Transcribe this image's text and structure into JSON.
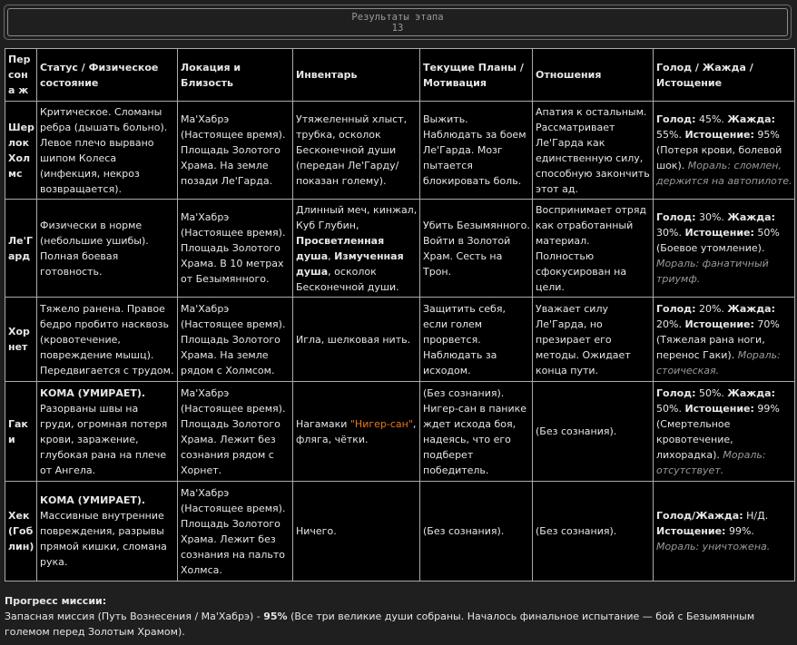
{
  "header": {
    "title": "Результаты этапа",
    "number": "13"
  },
  "columns": [
    "Пер сона ж",
    "Статус / Физическое состояние",
    "Локация и Близость",
    "Инвентарь",
    "Текущие Планы / Мотивация",
    "Отношения",
    "Голод / Жажда / Истощение"
  ],
  "rows": [
    {
      "name": "Шер лок Хол мс",
      "status_plain": "Критическое. Сломаны ребра (дышать больно). Левое плечо вырвано шипом Колеса (инфекция, некроз возвращается).",
      "location": "Ма'Хабрэ (Настоящее время). Площадь Золотого Храма. На земле позади Ле'Гарда.",
      "inventory_pre": "Утяжеленный хлыст, трубка, осколок Бесконечной души (передан Ле'Гарду/показан голему).",
      "plans": "Выжить. Наблюдать за боем Ле'Гарда. Мозг пытается блокировать боль.",
      "relations": "Апатия к остальным. Рассматривает Ле'Гарда как единственную силу, способную закончить этот ад.",
      "hunger_label": "Голод:",
      "hunger_val": " 45%. ",
      "thirst_label": "Жажда:",
      "thirst_val": " 55%.",
      "exhaust_label": "Истощение:",
      "exhaust_val": " 95% (Потеря крови, болевой шок).",
      "moral": "Мораль: сломлен, держится на автопилоте."
    },
    {
      "name": "Ле'Г ард",
      "status_plain": "Физически в норме (небольшие ушибы). Полная боевая готовность.",
      "location": "Ма'Хабрэ (Настоящее время). Площадь Золотого Храма. В 10 метрах от Безымянного.",
      "inventory_pre": "Длинный меч, кинжал, Куб Глубин, ",
      "inventory_b1": "Просветленная душа",
      "inventory_mid": ", ",
      "inventory_b2": "Измученная душа",
      "inventory_post": ", осколок Бесконечной души.",
      "plans": "Убить Безымянного. Войти в Золотой Храм. Сесть на Трон.",
      "relations": "Воспринимает отряд как отработанный материал. Полностью сфокусирован на цели.",
      "hunger_label": "Голод:",
      "hunger_val": " 30%. ",
      "thirst_label": "Жажда:",
      "thirst_val": " 30%.",
      "exhaust_label": "Истощение:",
      "exhaust_val": " 50% (Боевое утомление). ",
      "moral": "Мораль: фанатичный триумф."
    },
    {
      "name": "Хор нет",
      "status_plain": "Тяжело ранена. Правое бедро пробито насквозь (кровотечение, повреждение мышц). Передвигается с трудом.",
      "location": "Ма'Хабрэ (Настоящее время). Площадь Золотого Храма. На земле рядом с Холмсом.",
      "inventory_pre": "Игла, шелковая нить.",
      "plans": "Защитить себя, если голем прорвется. Наблюдать за исходом.",
      "relations": "Уважает силу Ле'Гарда, но презирает его методы. Ожидает конца пути.",
      "hunger_label": "Голод:",
      "hunger_val": " 20%. ",
      "thirst_label": "Жажда:",
      "thirst_val": " 20%.",
      "exhaust_label": "Истощение:",
      "exhaust_val": " 70% (Тяжелая рана ноги, перенос Гаки). ",
      "moral": "Мораль: стоическая."
    },
    {
      "name": "Гаки",
      "status_bold": "КОМА (УМИРАЕТ).",
      "status_plain": "Разорваны швы на груди, огромная потеря крови, заражение, глубокая рана на плече от Ангела.",
      "location": "Ма'Хабрэ (Настоящее время). Площадь Золотого Храма. Лежит без сознания рядом с Хорнет.",
      "inventory_pre": "Нагамаки ",
      "inventory_orange": "\"Нигер-сан\"",
      "inventory_post": ", фляга, чётки.",
      "plans": "(Без сознания). Нигер-сан в панике ждет исхода боя, надеясь, что его подберет победитель.",
      "relations": "(Без сознания).",
      "hunger_label": "Голод:",
      "hunger_val": " 50%. ",
      "thirst_label": "Жажда:",
      "thirst_val": " 50%.",
      "exhaust_label": "Истощение:",
      "exhaust_val": " 99% (Смертельное кровотечение, лихорадка). ",
      "moral": "Мораль: отсутствует."
    },
    {
      "name": "Хек (Гоб лин)",
      "status_bold": "КОМА (УМИРАЕТ).",
      "status_plain": "Массивные внутренние повреждения, разрывы прямой кишки, сломана рука.",
      "location": "Ма'Хабрэ (Настоящее время). Площадь Золотого Храма. Лежит без сознания на пальто Холмса.",
      "inventory_pre": "Ничего.",
      "plans": "(Без сознания).",
      "relations": "(Без сознания).",
      "hunger_label": "Голод/Жажда:",
      "hunger_val": " Н/Д.",
      "exhaust_label": "Истощение:",
      "exhaust_val": " 99%.",
      "moral": "Мораль: уничтожена."
    }
  ],
  "footer": {
    "heading": "Прогресс миссии:",
    "mission_plain": "Запасная миссия (Путь Вознесения / Ма'Хабрэ) - ",
    "mission_percent": "95%",
    "mission_rest": " (Все три великие души собраны. Началось финальное испытание — бой с Безымянным големом перед Золотым Храмом)."
  }
}
